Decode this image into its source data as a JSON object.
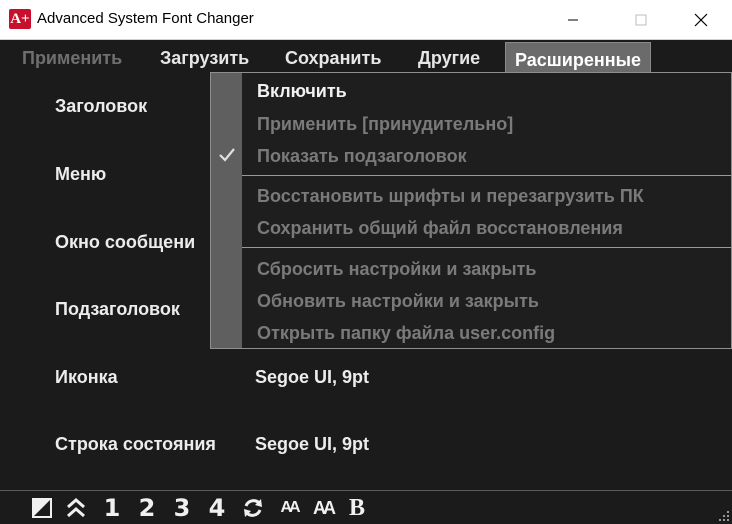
{
  "window": {
    "title": "Advanced System Font Changer",
    "icon_text": "A+",
    "minimize_icon": "minimize-icon",
    "maximize_icon": "maximize-icon",
    "close_icon": "close-icon"
  },
  "menubar": {
    "items": [
      {
        "label": "Применить",
        "state": "disabled"
      },
      {
        "label": "Загрузить",
        "state": "normal"
      },
      {
        "label": "Сохранить",
        "state": "normal"
      },
      {
        "label": "Другие",
        "state": "normal"
      },
      {
        "label": "Расширенные",
        "state": "active"
      }
    ]
  },
  "rows": [
    {
      "label": "Заголовок",
      "value": ""
    },
    {
      "label": "Меню",
      "value": ""
    },
    {
      "label": "Окно сообщени",
      "value": ""
    },
    {
      "label": "Подзаголовок",
      "value": ""
    },
    {
      "label": "Иконка",
      "value": "Segoe UI, 9pt"
    },
    {
      "label": "Строка состояния",
      "value": "Segoe UI, 9pt"
    }
  ],
  "dropdown": {
    "items": [
      {
        "label": "Включить",
        "enabled": true,
        "checked": false
      },
      {
        "label": "Применить [принудительно]",
        "enabled": false,
        "checked": false
      },
      {
        "label": "Показать подзаголовок",
        "enabled": false,
        "checked": true
      },
      {
        "label": "Восстановить шрифты и перезагрузить ПК",
        "enabled": false,
        "checked": false
      },
      {
        "label": "Сохранить общий файл восстановления",
        "enabled": false,
        "checked": false
      },
      {
        "label": "Сбросить настройки и закрыть",
        "enabled": false,
        "checked": false
      },
      {
        "label": "Обновить настройки и закрыть",
        "enabled": false,
        "checked": false
      },
      {
        "label": "Открыть папку файла user.config",
        "enabled": false,
        "checked": false
      }
    ],
    "check_icon": "checkmark-icon"
  },
  "statusbar": {
    "icons": [
      "theme-toggle-icon",
      "collapse-up-icon",
      "refresh-icon",
      "font-size-small-icon",
      "font-size-large-icon",
      "bold-icon"
    ],
    "preset_labels": [
      "1",
      "2",
      "3",
      "4"
    ],
    "font_small_label": "AA",
    "font_large_label": "AA",
    "bold_label": "B"
  },
  "colors": {
    "background": "#1b1b1b",
    "accent_icon": "#c8102e",
    "active_menu": "#6b6b6b",
    "dropdown_gutter": "#5f5f5f",
    "disabled_text": "#7a7a7a"
  }
}
